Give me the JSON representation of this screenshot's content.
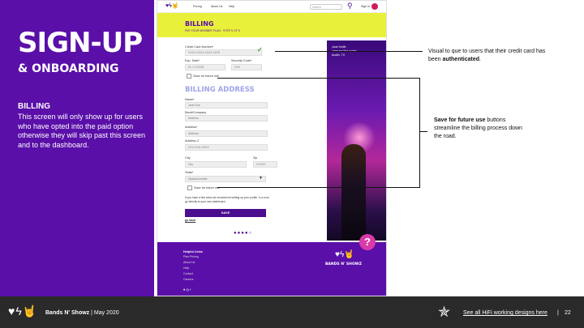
{
  "slide": {
    "title": "SIGN-UP",
    "subtitle": "& ONBOARDING",
    "section_heading": "BILLING",
    "section_body": "This screen will only show up for users who have opted into the paid option otherwise they will skip past this screen and to the dashboard."
  },
  "mock": {
    "nav": {
      "logo": "♥ϟ🤘",
      "items": [
        "Pricing",
        "About Us",
        "Help"
      ],
      "search_placeholder": "Search",
      "signin": "Sign In"
    },
    "header": {
      "title": "BILLING",
      "subtitle": "PAY YOUR MEMBER PLAN · STEP 5 OF 5"
    },
    "form": {
      "card_label": "Credit Card Number*",
      "card_value": "XXXX XXXX XXXX 1678",
      "exp_label": "Exp. Date*",
      "exp_value": "01 / 17/2024",
      "cvc_label": "Security Code*",
      "cvc_value": "XXX",
      "save_future_1": "Save for future use",
      "address_title": "BILLING ADDRESS",
      "name_label": "Name*",
      "name_value": "Jane Doe",
      "band_label": "Band/Company",
      "band_value": "Address",
      "addr_label": "Address*",
      "addr_value": "Address",
      "addr2_label": "Address 2",
      "addr2_value": "XXX-XXX-XXXX",
      "city_label": "City",
      "city_value": "City",
      "zip_label": "Zip",
      "zip_value": "XXXXX",
      "state_label": "State*",
      "state_value": "Massachusetts",
      "save_future_2": "Save for future use",
      "note": "If you have a few extra we recommend setting up your profile. In a rush go directly to your new dashboard.",
      "save_button": "SAVE",
      "go_back": "go back",
      "dots": "●●●●○"
    },
    "photo_text": [
      "Jane Smith",
      "Jane and the nodes",
      "Austin, TX"
    ],
    "footer": {
      "heading": "Helpful Links",
      "links": [
        "Plan Pricing",
        "About Us",
        "Help",
        "Contact",
        "Careers"
      ],
      "social": "♥ ◎ f",
      "logo": "♥ϟ🤘",
      "name": "BANDS N' SHOWZ",
      "help": "?"
    }
  },
  "annotations": {
    "auth_text_pre": "Visual to que to users that their credit card has been ",
    "auth_text_bold": "authenticated",
    "auth_text_post": ".",
    "save_bold": "Save for future use",
    "save_text": " buttons streamline the billing process down the road."
  },
  "footer": {
    "logo": "♥ϟ🤘",
    "brand": "Bands N' Showz",
    "date": " | May 2020",
    "star": "✯",
    "link": "See all HiFi working designs here",
    "sep": "|",
    "page": "22"
  }
}
